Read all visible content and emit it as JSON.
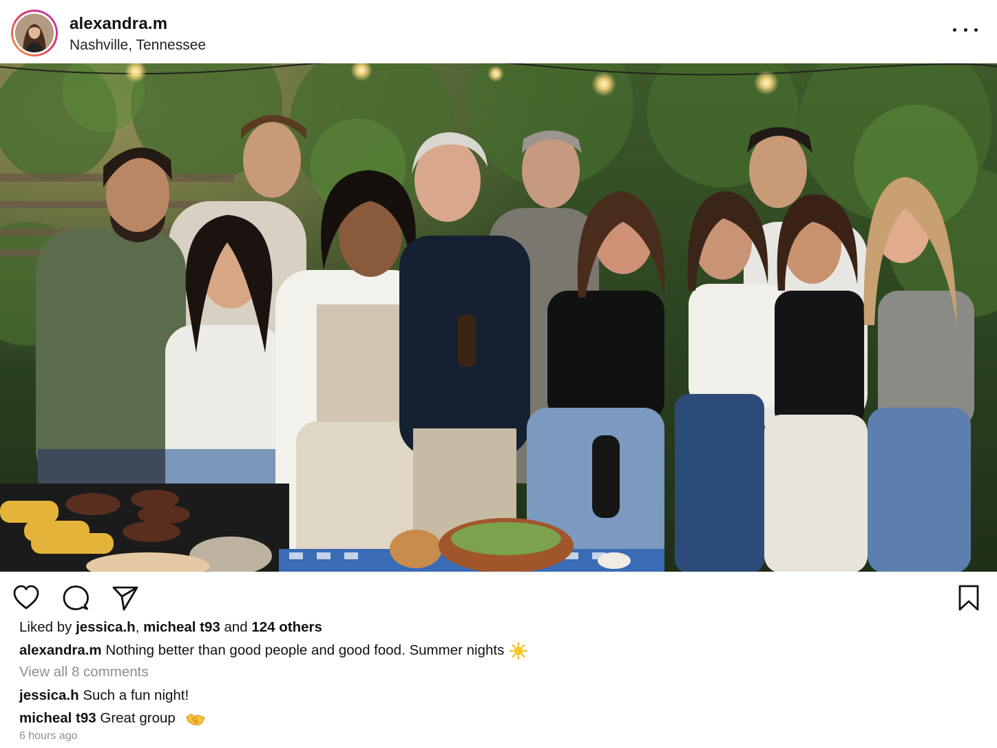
{
  "header": {
    "username": "alexandra.m",
    "location": "Nashville, Tennessee",
    "more_icon": "more-horizontal-icon"
  },
  "photo": {
    "subject_icon": "group-photo"
  },
  "actions": {
    "like_icon": "heart-icon",
    "comment_icon": "comment-bubble-icon",
    "share_icon": "send-icon",
    "save_icon": "bookmark-icon"
  },
  "likes": {
    "prefix": "Liked by ",
    "user1": "jessica.h",
    "separator": ", ",
    "user2": "micheal t93",
    "and_text": " and ",
    "others": "124 others"
  },
  "caption": {
    "username": "alexandra.m",
    "text": "Nothing better than good people and good food. Summer nights",
    "emoji": "sun-emoji"
  },
  "view_comments": "View all 8 comments",
  "comments": [
    {
      "username": "jessica.h",
      "text": "Such a fun night!",
      "emoji": ""
    },
    {
      "username": "micheal t93",
      "text": "Great group",
      "emoji": "handshake-emoji"
    }
  ],
  "timestamp": "6 hours ago",
  "colors": {
    "story_ring_start": "#f9a23a",
    "story_ring_end": "#b43fbd",
    "muted_text": "#8e8e8e"
  }
}
